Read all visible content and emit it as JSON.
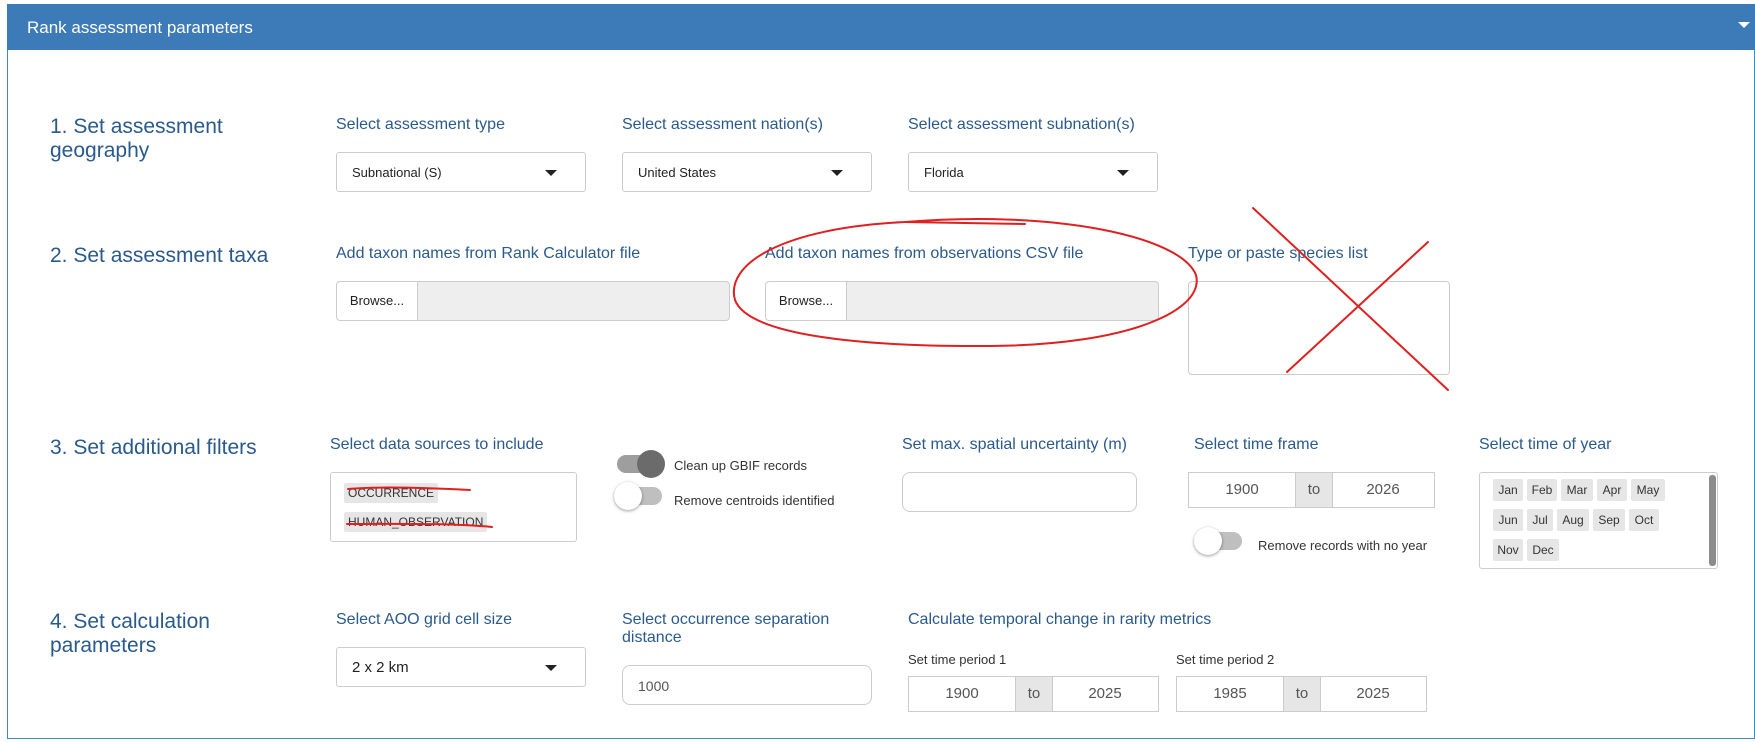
{
  "panel": {
    "title": "Rank assessment parameters"
  },
  "steps": {
    "geography": "1. Set assessment geography",
    "taxa": "2. Set assessment taxa",
    "filters": "3. Set additional filters",
    "calc": "4. Set calculation parameters"
  },
  "geography": {
    "type_label": "Select assessment type",
    "type_value": "Subnational (S)",
    "nation_label": "Select assessment nation(s)",
    "nation_value": "United States",
    "subnation_label": "Select assessment subnation(s)",
    "subnation_value": "Florida"
  },
  "taxa": {
    "rank_calc_label": "Add taxon names from Rank Calculator file",
    "rank_calc_browse": "Browse...",
    "obs_csv_label": "Add taxon names from observations CSV file",
    "obs_csv_browse": "Browse...",
    "species_list_label": "Type or paste species list"
  },
  "filters": {
    "sources_label": "Select data sources to include",
    "sources": [
      "OCCURRENCE",
      "HUMAN_OBSERVATION"
    ],
    "gbif_toggle_label": "Clean up GBIF records",
    "gbif_toggle_on": true,
    "centroid_toggle_label": "Remove centroids identified",
    "centroid_toggle_on": false,
    "uncertainty_label": "Set max. spatial uncertainty (m)",
    "uncertainty_value": "",
    "timeframe_label": "Select time frame",
    "timeframe_start": "1900",
    "timeframe_to": "to",
    "timeframe_end": "2026",
    "no_year_toggle_label": "Remove records with no year",
    "no_year_toggle_on": false,
    "time_of_year_label": "Select time of year",
    "months": [
      "Jan",
      "Feb",
      "Mar",
      "Apr",
      "May",
      "Jun",
      "Jul",
      "Aug",
      "Sep",
      "Oct",
      "Nov",
      "Dec"
    ]
  },
  "calc": {
    "aoo_label": "Select AOO grid cell size",
    "aoo_value": "2 x 2 km",
    "separation_label": "Select occurrence separation distance",
    "separation_value": "1000",
    "temporal_label": "Calculate temporal change in rarity metrics",
    "period1_label": "Set time period 1",
    "period1_start": "1900",
    "period1_to": "to",
    "period1_end": "2025",
    "period2_label": "Set time period 2",
    "period2_start": "1985",
    "period2_to": "to",
    "period2_end": "2025"
  },
  "colors": {
    "header": "#3c7ab8",
    "label": "#2a5a8c",
    "annotation": "#e02020"
  }
}
